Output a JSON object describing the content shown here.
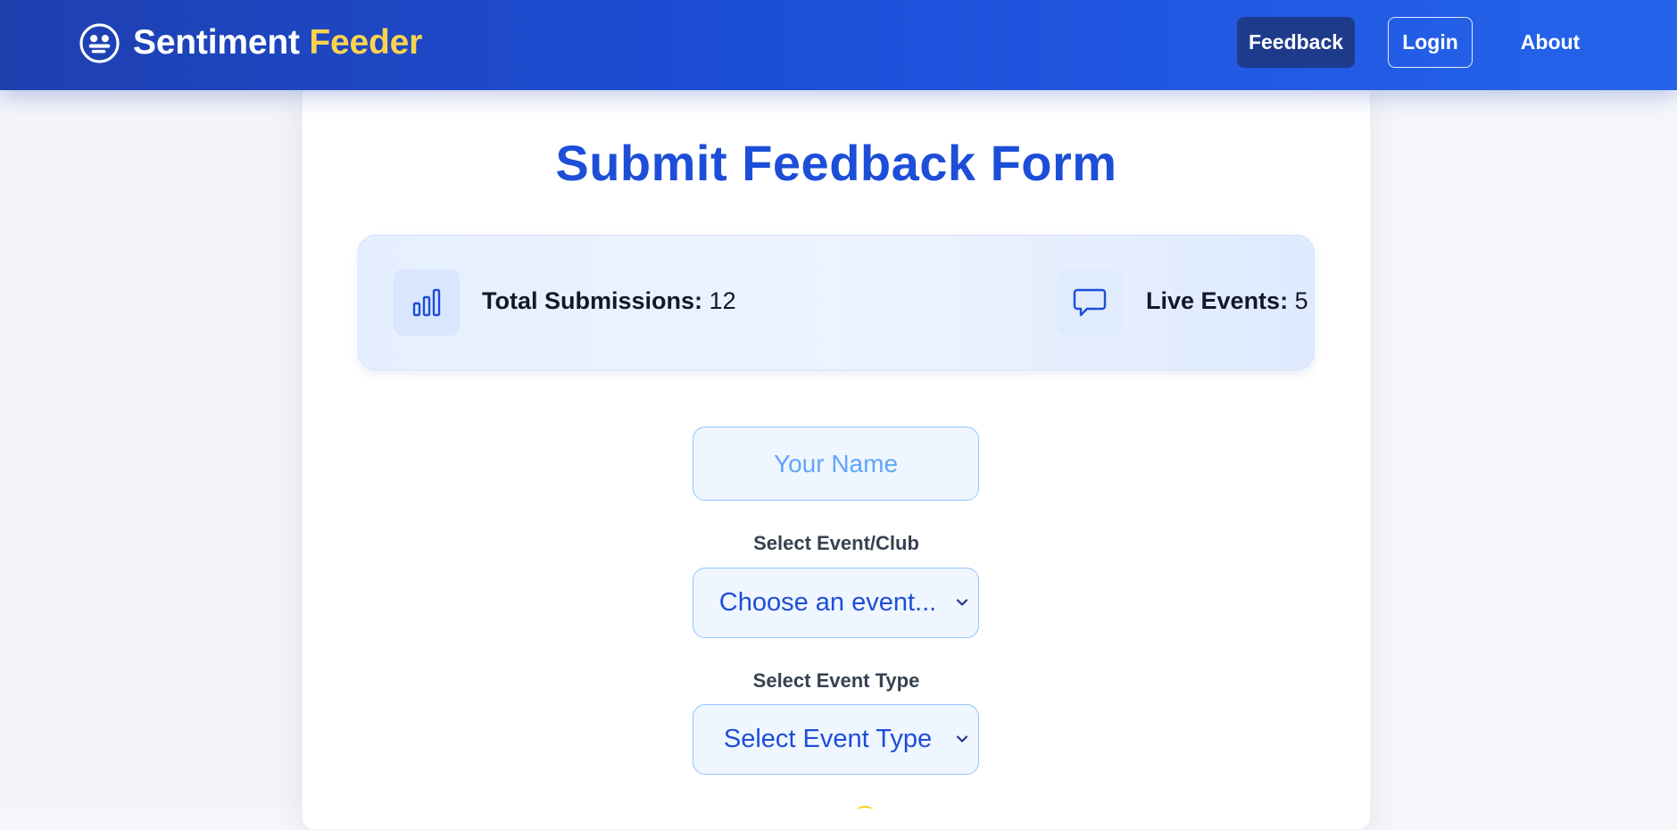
{
  "header": {
    "brand_word1": "Sentiment",
    "brand_word2": "Feeder",
    "brand_icon": "smiley-logo-icon",
    "nav": {
      "feedback": "Feedback",
      "login": "Login",
      "about": "About"
    }
  },
  "form": {
    "title": "Submit Feedback Form",
    "stats": {
      "submissions_label": "Total Submissions:",
      "submissions_value": "12",
      "submissions_icon": "bar-chart-icon",
      "events_label": "Live Events:",
      "events_value": "5",
      "events_icon": "chat-bubble-icon"
    },
    "name_placeholder": "Your Name",
    "event_label": "Select Event/Club",
    "event_selected": "Choose an event...",
    "type_label": "Select Event Type",
    "type_selected": "Select Event Type"
  },
  "colors": {
    "primary": "#1d4ed8",
    "accent": "#fcd34d",
    "header_dark": "#1e3a8a",
    "input_bg": "#eff6ff",
    "input_border": "#93c5fd"
  }
}
